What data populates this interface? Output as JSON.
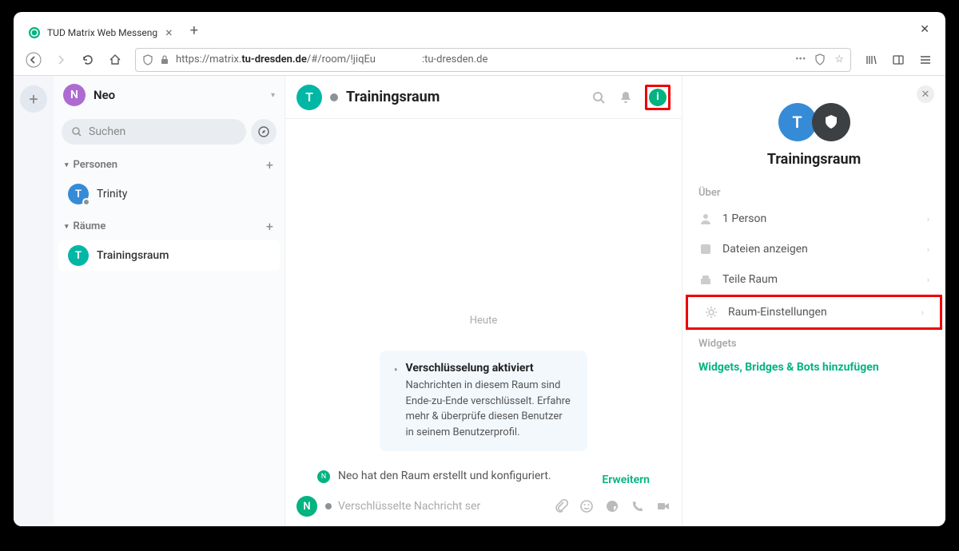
{
  "browser": {
    "tab_title": "TUD Matrix Web Messeng",
    "url_prefix": "https://matrix.",
    "url_domain": "tu-dresden.de",
    "url_path": "/#/room/!jiqEu",
    "url_suffix": ":tu-dresden.de"
  },
  "user": {
    "initial": "N",
    "name": "Neo"
  },
  "search": {
    "placeholder": "Suchen"
  },
  "sections": {
    "people": "Personen",
    "rooms": "Räume"
  },
  "people": [
    {
      "initial": "T",
      "name": "Trinity"
    }
  ],
  "rooms": [
    {
      "initial": "T",
      "name": "Trainingsraum",
      "selected": true
    }
  ],
  "room": {
    "initial": "T",
    "name": "Trainingsraum"
  },
  "timeline": {
    "date": "Heute",
    "e2e_title": "Verschlüsselung aktiviert",
    "e2e_body": "Nachrichten in diesem Raum sind Ende-zu-Ende verschlüsselt. Erfahre mehr & überprüfe diesen Benutzer in seinem Benutzerprofil.",
    "event_initial": "N",
    "event_text": "Neo hat den Raum erstellt und konfiguriert.",
    "expand": "Erweitern"
  },
  "composer": {
    "placeholder": "Verschlüsselte Nachricht ser"
  },
  "rightpanel": {
    "title": "Trainingsraum",
    "about": "Über",
    "items": {
      "people": "1 Person",
      "files": "Dateien anzeigen",
      "share": "Teile Raum",
      "settings": "Raum-Einstellungen"
    },
    "widgets_label": "Widgets",
    "widgets_link": "Widgets, Bridges & Bots hinzufügen"
  }
}
